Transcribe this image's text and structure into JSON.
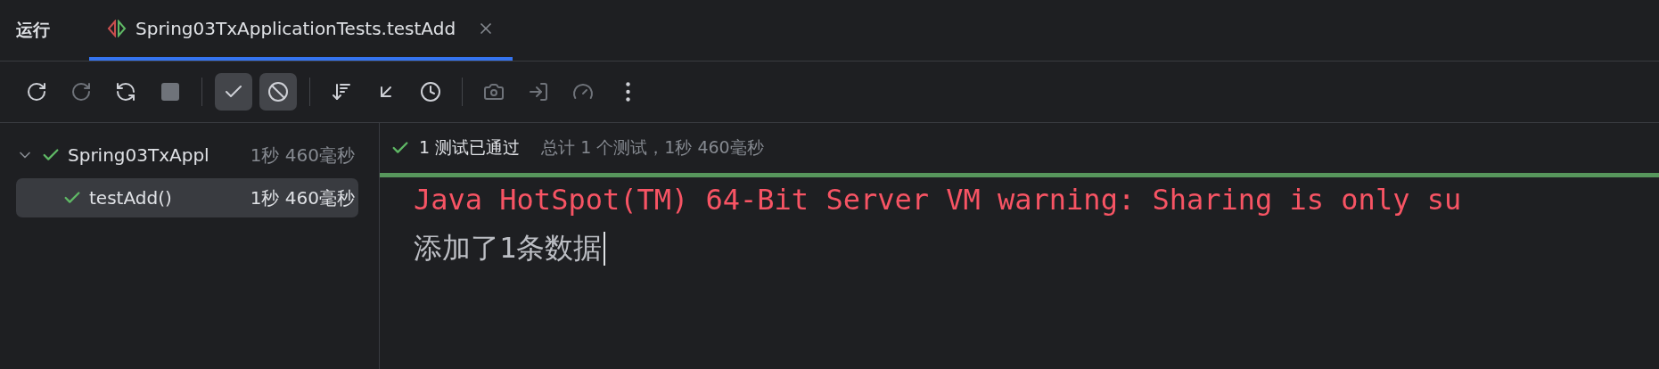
{
  "panel_title": "运行",
  "tabs": [
    {
      "label": "Spring03TxApplicationTests.testAdd",
      "selected": true
    }
  ],
  "toolbar": [
    {
      "kind": "rerun",
      "disabled": false,
      "selected": false
    },
    {
      "kind": "rerun-failed",
      "disabled": true,
      "selected": false
    },
    {
      "kind": "auto-rerun",
      "disabled": false,
      "selected": false
    },
    {
      "kind": "stop",
      "disabled": true,
      "selected": false
    },
    {
      "kind": "separator"
    },
    {
      "kind": "show-passed",
      "disabled": false,
      "selected": true
    },
    {
      "kind": "show-ignored",
      "disabled": false,
      "selected": true
    },
    {
      "kind": "separator"
    },
    {
      "kind": "sort",
      "disabled": false,
      "selected": false
    },
    {
      "kind": "collapse",
      "disabled": false,
      "selected": false
    },
    {
      "kind": "history",
      "disabled": false,
      "selected": false
    },
    {
      "kind": "separator"
    },
    {
      "kind": "camera",
      "disabled": true,
      "selected": false
    },
    {
      "kind": "import",
      "disabled": true,
      "selected": false
    },
    {
      "kind": "coverage",
      "disabled": true,
      "selected": false
    },
    {
      "kind": "more",
      "disabled": false,
      "selected": false
    }
  ],
  "tree": [
    {
      "label": "Spring03TxAppl",
      "duration": "1秒 460毫秒",
      "passed": true,
      "expanded": true,
      "selected": false,
      "children": [
        {
          "label": "testAdd()",
          "duration": "1秒 460毫秒",
          "passed": true,
          "selected": true
        }
      ]
    }
  ],
  "summary": {
    "status": "1 测试已通过",
    "detail": "总计 1 个测试，1秒 460毫秒",
    "passed": true
  },
  "console": [
    {
      "kind": "error",
      "text": "Java HotSpot(TM) 64-Bit Server VM warning: Sharing is only su"
    },
    {
      "kind": "output",
      "text": "添加了1条数据"
    }
  ]
}
